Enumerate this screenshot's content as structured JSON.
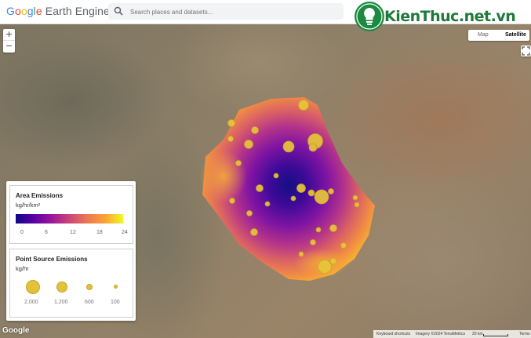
{
  "header": {
    "logo_parts": [
      "G",
      "o",
      "o",
      "g",
      "l",
      "e"
    ],
    "logo_rest": " Earth Engine",
    "search_placeholder": "Search places and datasets..."
  },
  "watermark": {
    "text": "KienThuc.net.vn"
  },
  "map_type": {
    "map_label": "Map",
    "satellite_label": "Satellite",
    "selected": "Satellite"
  },
  "zoom": {
    "in_label": "+",
    "out_label": "−"
  },
  "legend": {
    "area": {
      "title": "Area Emissions",
      "unit": "kg/hr/km²",
      "ticks": [
        "0",
        "6",
        "12",
        "18",
        "24"
      ],
      "colors": [
        "#0d0887",
        "#5b02a3",
        "#9a179b",
        "#cb4678",
        "#eb7852",
        "#fba238",
        "#f0f921"
      ]
    },
    "point": {
      "title": "Point Source Emissions",
      "unit": "kg/hr",
      "values": [
        "2,000",
        "1,200",
        "600",
        "100"
      ]
    }
  },
  "footer": {
    "shortcuts": "Keyboard shortcuts",
    "imagery": "Imagery ©2024 TerraMetrics",
    "scale": "20 km",
    "terms": "Terms"
  },
  "google_logo": "Google"
}
